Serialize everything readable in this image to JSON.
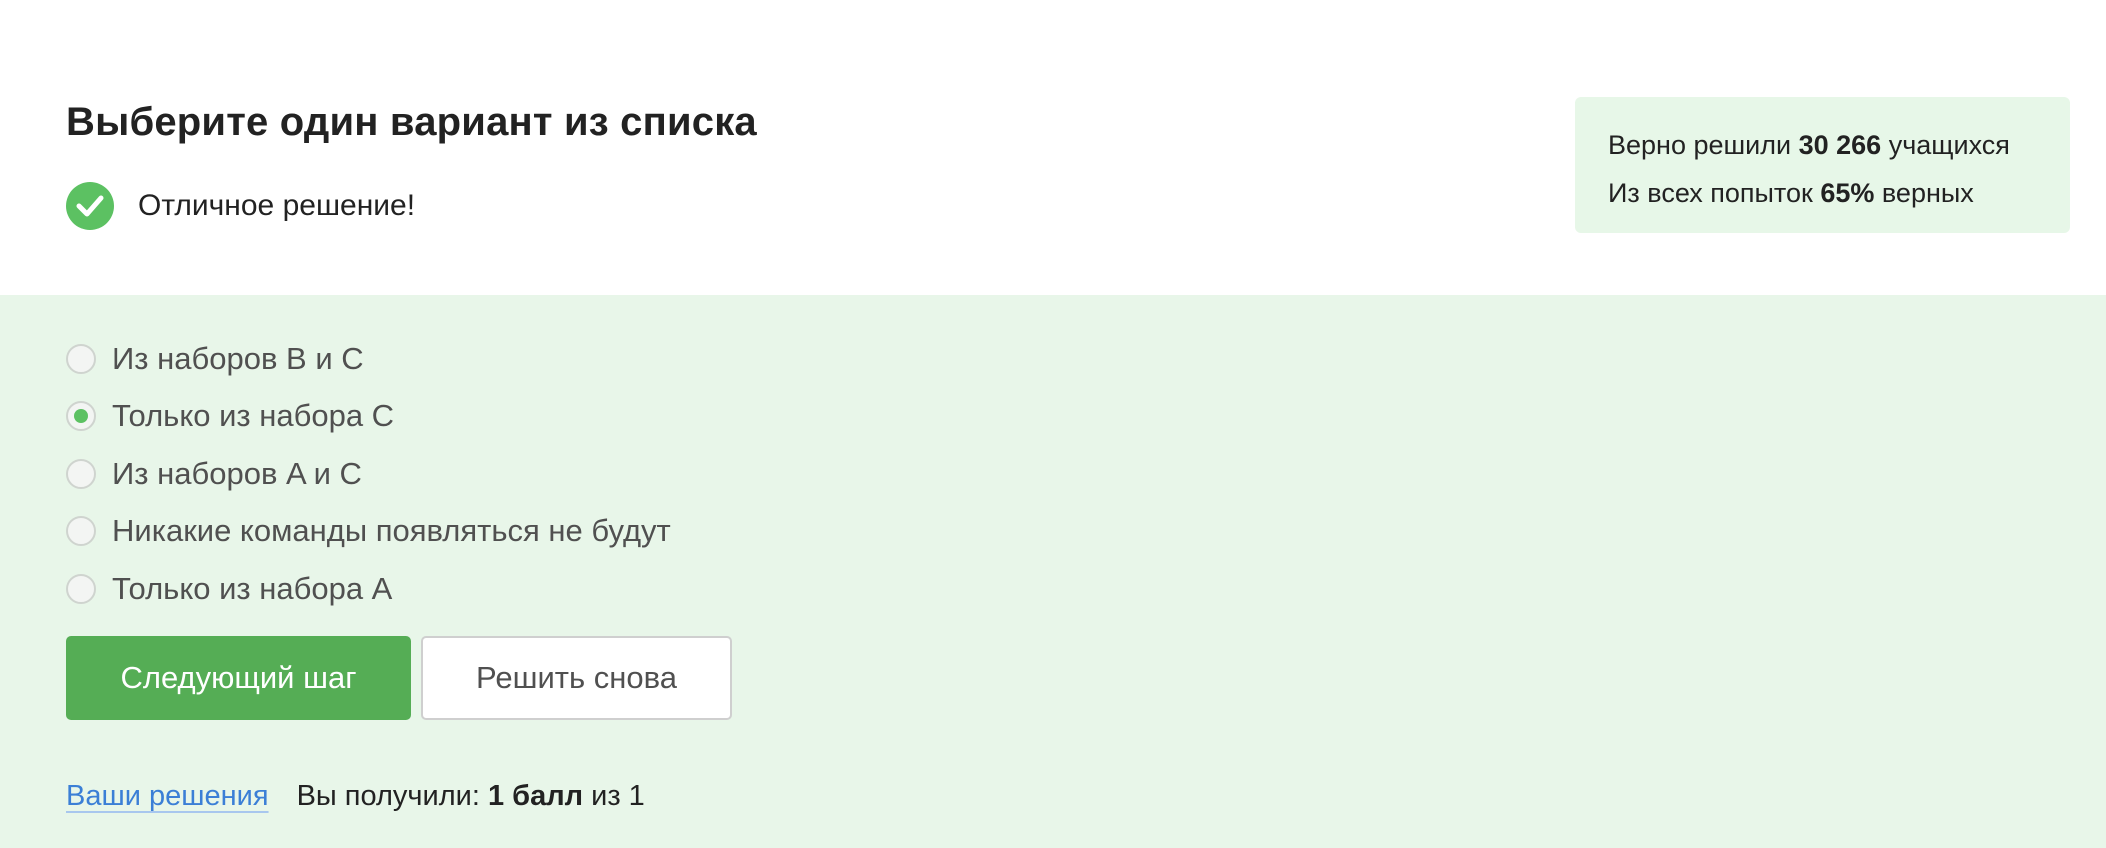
{
  "header": {
    "title": "Выберите один вариант из списка",
    "feedback": "Отличное решение!"
  },
  "stats": {
    "solved_prefix": "Верно решили",
    "solved_count": "30 266",
    "solved_suffix": "учащихся",
    "attempts_prefix": "Из всех попыток",
    "attempts_percent": "65%",
    "attempts_suffix": "верных"
  },
  "options": [
    {
      "label": "Из наборов B и C",
      "selected": false
    },
    {
      "label": "Только из набора C",
      "selected": true
    },
    {
      "label": "Из наборов A и C",
      "selected": false
    },
    {
      "label": "Никакие команды появляться не будут",
      "selected": false
    },
    {
      "label": "Только из набора A",
      "selected": false
    }
  ],
  "actions": {
    "next_label": "Следующий шаг",
    "retry_label": "Решить снова"
  },
  "footer": {
    "solutions_link": "Ваши решения",
    "score_prefix": "Вы получили:",
    "score_value": "1 балл",
    "score_suffix": "из 1"
  },
  "colors": {
    "accent_green": "#55ad55",
    "check_green": "#5cc162",
    "panel_bg": "#e8f6e9",
    "link_blue": "#3b7fd6"
  }
}
